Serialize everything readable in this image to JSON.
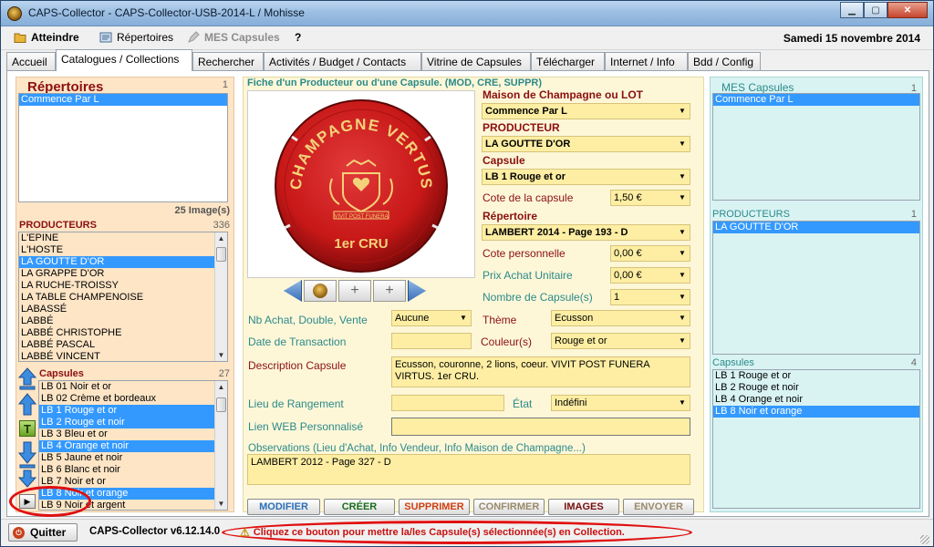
{
  "window": {
    "title": "CAPS-Collector - CAPS-Collector-USB-2014-L / Mohisse"
  },
  "menu": {
    "atteindre": "Atteindre",
    "repertoires": "Répertoires",
    "mes_capsules": "MES Capsules",
    "help": "?",
    "date": "Samedi 15 novembre 2014"
  },
  "tabs": [
    "Accueil",
    "Catalogues / Collections",
    "Rechercher",
    "Activités / Budget / Contacts",
    "Vitrine de Capsules",
    "Télécharger",
    "Internet / Info",
    "Bdd / Config"
  ],
  "left": {
    "repertoires_title": "Répertoires",
    "repertoires_count": "1",
    "repertoires": [
      "Commence Par L"
    ],
    "images_count": "25 Image(s)",
    "producteurs_title": "PRODUCTEURS",
    "producteurs_count": "336",
    "producteurs": [
      "L'EPINE",
      "L'HOSTE",
      "LA GOUTTE D'OR",
      "LA GRAPPE D'OR",
      "LA RUCHE-TROISSY",
      "LA TABLE CHAMPENOISE",
      "LABASSÉ",
      "LABBÉ",
      "LABBÉ CHRISTOPHE",
      "LABBÉ PASCAL",
      "LABBÉ VINCENT"
    ],
    "capsules_title": "Capsules",
    "capsules_count": "27",
    "capsules": [
      "LB 01 Noir et or",
      "LB 02 Crème et bordeaux",
      "LB 1 Rouge et or",
      "LB 2 Rouge et noir",
      "LB 3 Bleu et or",
      "LB 4 Orange et noir",
      "LB 5 Jaune et noir",
      "LB 6 Blanc et noir",
      "LB 7 Noir et or",
      "LB 8 Noir et orange",
      "LB 9 Noir et argent"
    ],
    "t_button": "T"
  },
  "center": {
    "fiche_title": "Fiche d'un Producteur ou d'une Capsule. (MOD, CRE, SUPPR)",
    "cap_text_top": "CHAMPAGNE VERTUS",
    "cap_text_bottom": "1er CRU",
    "cap_motto": "VIVIT POST FUNERA",
    "maison_label": "Maison de Champagne ou LOT",
    "maison_value": "Commence Par L",
    "producteur_label": "PRODUCTEUR",
    "producteur_value": "LA GOUTTE D'OR",
    "capsule_label": "Capsule",
    "capsule_value": "LB 1 Rouge et or",
    "cote_label": "Cote de la capsule",
    "cote_value": "1,50 €",
    "repertoire_label": "Répertoire",
    "repertoire_value": "LAMBERT 2014 - Page 193 - D",
    "cote_perso_label": "Cote personnelle",
    "cote_perso_value": "0,00 €",
    "prix_label": "Prix Achat Unitaire",
    "prix_value": "0,00 €",
    "nombre_label": "Nombre de Capsule(s)",
    "nombre_value": "1",
    "nb_achat_label": "Nb Achat, Double, Vente",
    "nb_achat_value": "Aucune",
    "theme_label": "Thème",
    "theme_value": "Ecusson",
    "date_label": "Date de Transaction",
    "date_value": "",
    "couleur_label": "Couleur(s)",
    "couleur_value": "Rouge et or",
    "description_label": "Description Capsule",
    "description_value": "Ecusson, couronne, 2 lions, coeur. VIVIT POST FUNERA VIRTUS. 1er CRU.",
    "lieu_label": "Lieu de Rangement",
    "lieu_value": "",
    "etat_label": "État",
    "etat_value": "Indéfini",
    "lien_label": "Lien WEB Personnalisé",
    "lien_value": "",
    "obs_label": "Observations (Lieu d'Achat, Info Vendeur, Info Maison de Champagne...)",
    "obs_value": "LAMBERT 2012 - Page 327 - D"
  },
  "buttons": {
    "modifier": "MODIFIER",
    "creer": "CRÉER",
    "supprimer": "SUPPRIMER",
    "confirmer": "CONFIRMER",
    "images": "IMAGES",
    "envoyer": "ENVOYER"
  },
  "right": {
    "mes_title": "MES Capsules",
    "mes_count": "1",
    "mes": [
      "Commence Par L"
    ],
    "prod_title": "PRODUCTEURS",
    "prod_count": "1",
    "prod": [
      "LA GOUTTE D'OR"
    ],
    "caps_title": "Capsules",
    "caps_count": "4",
    "caps": [
      "LB 1 Rouge et or",
      "LB 2 Rouge et noir",
      "LB 4 Orange et noir",
      "LB 8 Noir et orange"
    ]
  },
  "status": {
    "quit": "Quitter",
    "version": "CAPS-Collector v6.12.14.0",
    "hint": "Cliquez ce bouton pour mettre la/les Capsule(s) sélectionnée(s) en Collection."
  },
  "colors": {
    "accent_red": "#8b1010",
    "teal": "#2c8a8a",
    "selection": "#3399ff",
    "field": "#fdeea3",
    "highlight_ring": "#e01010"
  }
}
